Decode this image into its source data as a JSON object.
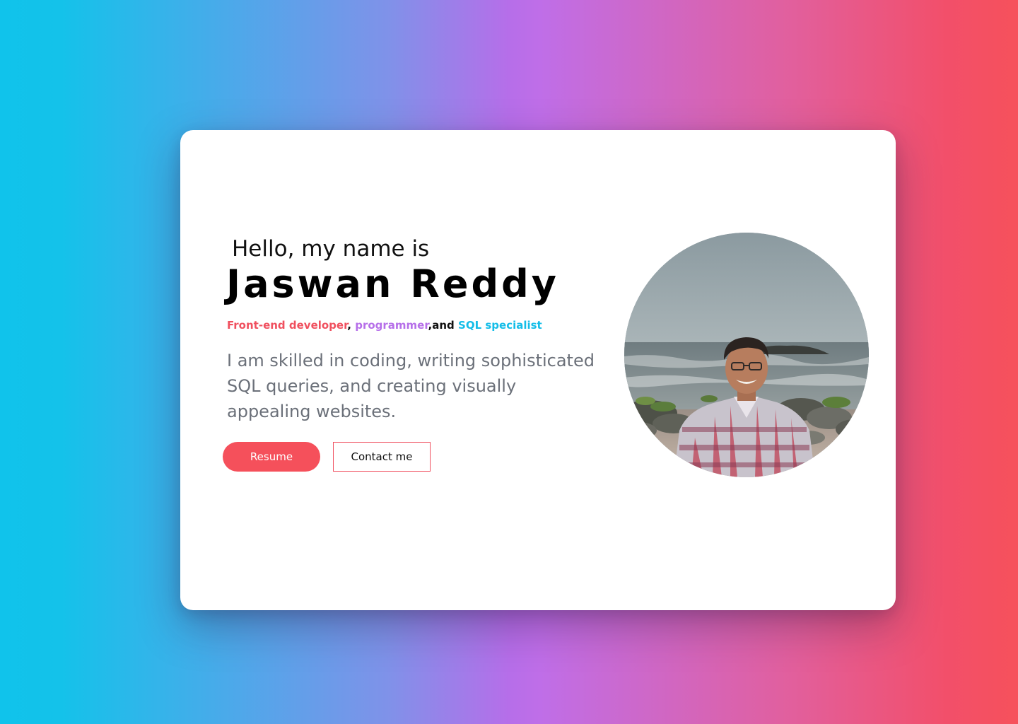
{
  "hero": {
    "greeting": "Hello, my name is",
    "name": "Jaswan Reddy",
    "roles": {
      "role1": "Front-end developer",
      "sep1": ", ",
      "role2": "programmer",
      "sep2": ",and ",
      "role3": "SQL specialist"
    },
    "bio": "I am skilled in coding, writing sophisticated SQL queries, and creating visually appealing websites.",
    "buttons": {
      "resume_label": "Resume",
      "contact_label": "Contact me"
    },
    "photo_icon": "profile-photo"
  },
  "colors": {
    "accent_red": "#f5505b",
    "accent_purple": "#b66fe9",
    "accent_cyan": "#14bde8",
    "bg_gradient_left": "#10c3eb",
    "bg_gradient_mid": "#bf6ee8",
    "bg_gradient_right": "#f6515b"
  }
}
